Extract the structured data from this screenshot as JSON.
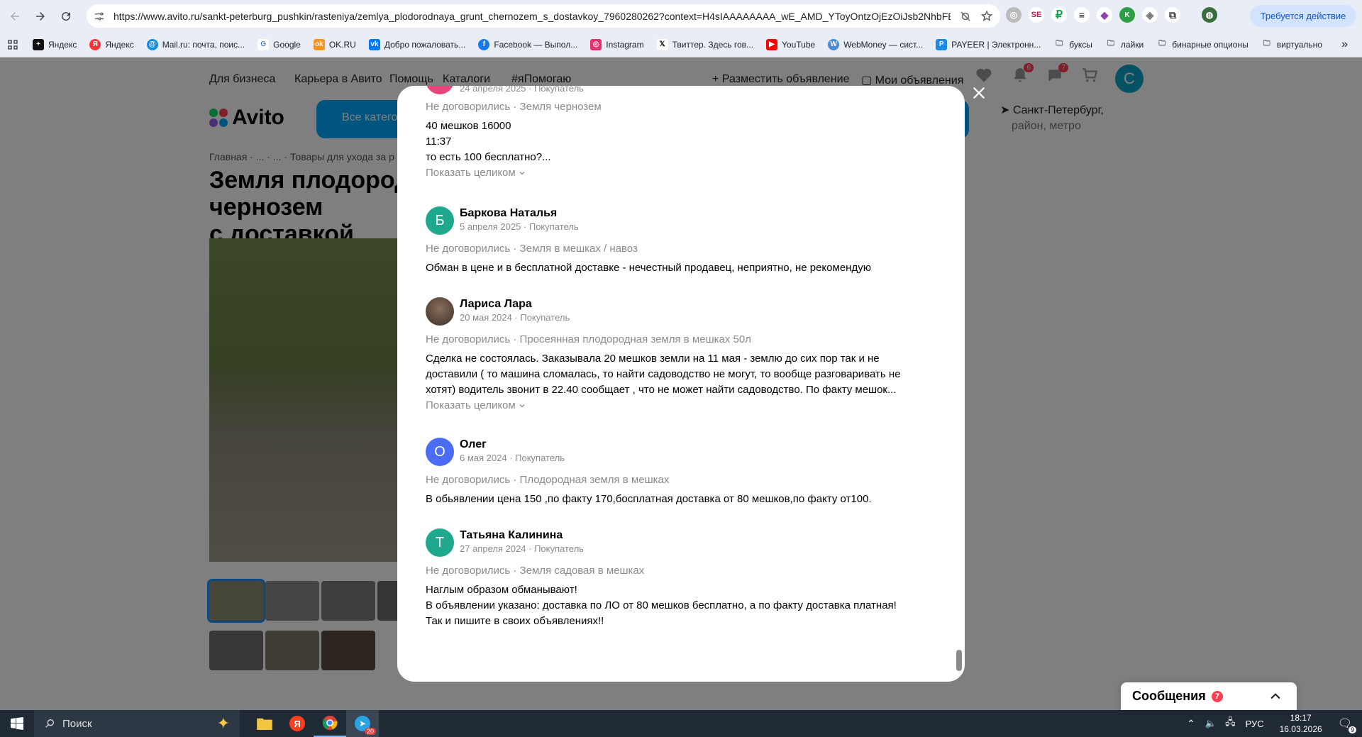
{
  "browser": {
    "url": "https://www.avito.ru/sankt-peterburg_pushkin/rasteniya/zemlya_plodorodnaya_grunt_chernozem_s_dostavkoy_7960280262?context=H4sIAAAAAAAA_wE_AMD_YToyOntzOjEzOiJsb2NhbFB...",
    "action_button": "Требуется действие",
    "bookmarks": [
      "Яндекс",
      "Яндекс",
      "Mail.ru: почта, поис...",
      "Google",
      "OK.RU",
      "Добро пожаловать...",
      "Facebook — Выпол...",
      "Instagram",
      "Твиттер. Здесь гов...",
      "YouTube",
      "WebMoney — сист...",
      "PAYEER | Электронн...",
      "буксы",
      "лайки",
      "бинарные опционы",
      "виртуально"
    ]
  },
  "site": {
    "topnav": {
      "business": "Для бизнеса",
      "career": "Карьера в Авито",
      "help": "Помощь",
      "catalogs": "Каталоги",
      "ihelp": "#яПомогаю",
      "post_ad": "Разместить объявление",
      "my_ads": "Мои объявления"
    },
    "notif_count": "6",
    "chat_count": "7",
    "user_initial": "С",
    "logo": "Avito",
    "all_categories": "Все категории",
    "breadcrumbs": "Главная · ... · ... · Товары для ухода за р",
    "title_line1": "Земля плодородная грунт чернозем",
    "title_line2": "с доставкой",
    "location_city": "Санкт-Петербург,",
    "location_sub": "район, метро",
    "messages_widget": {
      "label": "Сообщения",
      "count": "7"
    }
  },
  "modal": {
    "top_meta": "24 апреля 2025 · Покупатель",
    "reviews": [
      {
        "deal": "Не договорились · Земля чернозем",
        "lines": [
          "40 мешков 16000",
          "11:37",
          "то есть 100 бесплатно?..."
        ],
        "more": "Показать целиком"
      },
      {
        "name": "Баркова Наталья",
        "initial": "Б",
        "avatar_color": "#1fa88e",
        "meta": "5 апреля 2025 · Покупатель",
        "deal": "Не договорились · Земля в мешках / навоз",
        "lines": [
          "Обман в цене и в бесплатной доставке - нечестный продавец, неприятно, не рекомендую"
        ]
      },
      {
        "name": "Лариса Лара",
        "meta": "20 мая 2024 · Покупатель",
        "deal": "Не договорились · Просеянная плодородная земля в мешках 50л",
        "lines": [
          "Сделка не состоялась. Заказывала 20 мешков земли на 11 мая - землю до сих пор так и не",
          "доставили ( то машина сломалась, то найти садоводство не могут, то вообще разговаривать не",
          "хотят) водитель звонит в 22.40 сообщает , что не может найти садоводство. По факту мешок..."
        ],
        "more": "Показать целиком"
      },
      {
        "name": "Олег",
        "initial": "О",
        "avatar_color": "#4a6cf7",
        "meta": "6 мая 2024 · Покупатель",
        "deal": "Не договорились · Плодородная земля в мешках",
        "lines": [
          "В обьявлении цена 150 ,по факту 170,босплатная доставка от 80 мешков,по факту от100."
        ]
      },
      {
        "name": "Татьяна Калинина",
        "initial": "Т",
        "avatar_color": "#1fa88e",
        "meta": "27 апреля 2024 · Покупатель",
        "deal": "Не договорились · Земля садовая в мешках",
        "lines": [
          "Наглым образом обманывают!",
          "В объявлении указано: доставка по ЛО от 80 мешков бесплатно, а по факту доставка платная!",
          "Так и пишите в своих объявлениях!!"
        ]
      }
    ]
  },
  "taskbar": {
    "search": "Поиск",
    "telegram_badge": "20",
    "lang": "РУС",
    "time": "18:17",
    "date": "16.03.2026",
    "notif": "9"
  }
}
